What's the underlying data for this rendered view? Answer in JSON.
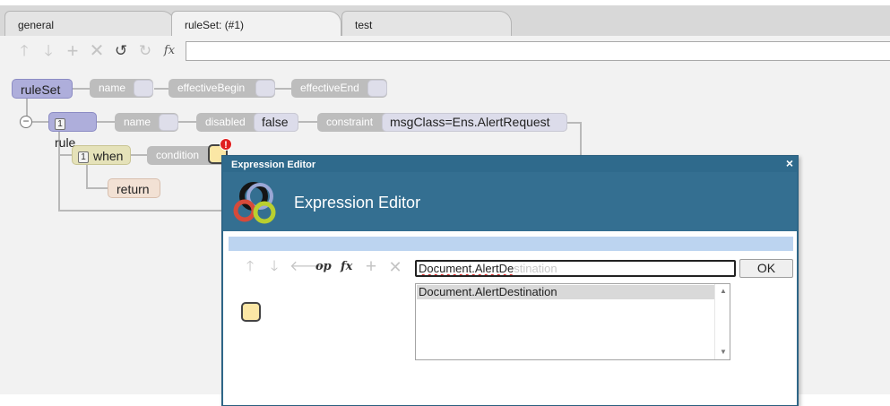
{
  "tabs": [
    {
      "label": "general"
    },
    {
      "label": "ruleSet: (#1)"
    },
    {
      "label": "test"
    }
  ],
  "toolbar": {
    "icons": [
      "arrow-up-icon",
      "arrow-down-icon",
      "plus-icon",
      "close-icon",
      "undo-icon",
      "redo-icon",
      "fx-icon"
    ],
    "fx_label": "fx",
    "formula_value": ""
  },
  "tree": {
    "ruleset": {
      "label": "ruleSet",
      "props": {
        "name": "name",
        "effective_begin": "effectiveBegin",
        "effective_end": "effectiveEnd"
      }
    },
    "rule": {
      "index": "1",
      "label": "rule",
      "props": {
        "name": "name",
        "disabled": "disabled",
        "disabled_value": "false",
        "constraint": "constraint",
        "constraint_value": "msgClass=Ens.AlertRequest"
      }
    },
    "when": {
      "index": "1",
      "label": "when",
      "props": {
        "condition": "condition"
      },
      "error_badge": "!"
    },
    "return": {
      "label": "return"
    }
  },
  "dialog": {
    "title": "Expression Editor",
    "heading": "Expression Editor",
    "close": "×",
    "toolbar": {
      "op_label": "op",
      "fx_label": "fx"
    },
    "expression": {
      "typed": "Document.AlertDe",
      "completion": "stination"
    },
    "ok_label": "OK",
    "suggestions": [
      "Document.AlertDestination"
    ]
  },
  "colors": {
    "dialog_header": "#346f91",
    "ruleset_node": "#aeaedb",
    "when_node": "#e5e2b9",
    "return_node": "#f2e1d4",
    "condition_slot": "#fbe7a5",
    "error": "#e02020"
  }
}
